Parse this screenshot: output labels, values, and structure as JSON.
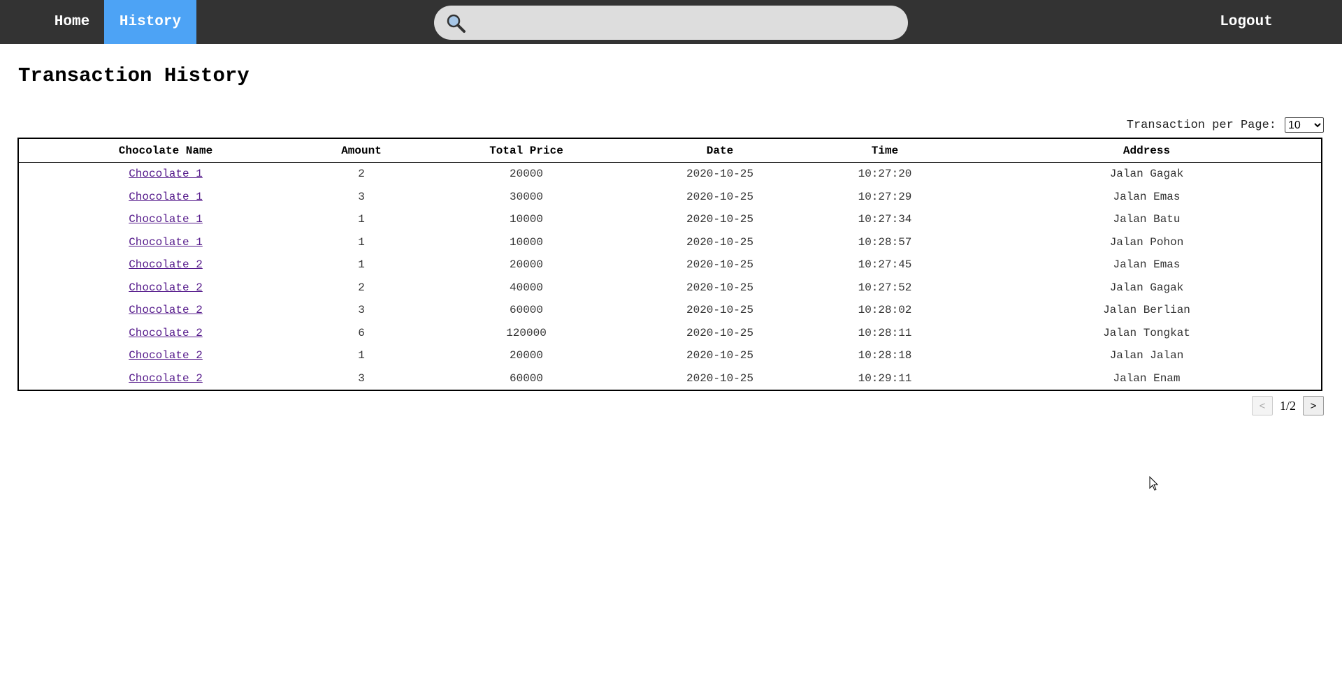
{
  "nav": {
    "home": "Home",
    "history": "History",
    "logout": "Logout"
  },
  "search": {
    "icon": "search-icon",
    "value": "",
    "placeholder": ""
  },
  "page_title": "Transaction History",
  "per_page": {
    "label": "Transaction per Page:",
    "selected": "10"
  },
  "table": {
    "headers": [
      "Chocolate Name",
      "Amount",
      "Total Price",
      "Date",
      "Time",
      "Address"
    ],
    "rows": [
      [
        "Chocolate 1",
        "2",
        "20000",
        "2020-10-25",
        "10:27:20",
        "Jalan Gagak"
      ],
      [
        "Chocolate 1",
        "3",
        "30000",
        "2020-10-25",
        "10:27:29",
        "Jalan Emas"
      ],
      [
        "Chocolate 1",
        "1",
        "10000",
        "2020-10-25",
        "10:27:34",
        "Jalan Batu"
      ],
      [
        "Chocolate 1",
        "1",
        "10000",
        "2020-10-25",
        "10:28:57",
        "Jalan Pohon"
      ],
      [
        "Chocolate 2",
        "1",
        "20000",
        "2020-10-25",
        "10:27:45",
        "Jalan Emas"
      ],
      [
        "Chocolate 2",
        "2",
        "40000",
        "2020-10-25",
        "10:27:52",
        "Jalan Gagak"
      ],
      [
        "Chocolate 2",
        "3",
        "60000",
        "2020-10-25",
        "10:28:02",
        "Jalan Berlian"
      ],
      [
        "Chocolate 2",
        "6",
        "120000",
        "2020-10-25",
        "10:28:11",
        "Jalan Tongkat"
      ],
      [
        "Chocolate 2",
        "1",
        "20000",
        "2020-10-25",
        "10:28:18",
        "Jalan Jalan"
      ],
      [
        "Chocolate 2",
        "3",
        "60000",
        "2020-10-25",
        "10:29:11",
        "Jalan Enam"
      ]
    ]
  },
  "pager": {
    "prev": "<",
    "next": ">",
    "indicator": "1/2"
  },
  "colors": {
    "navbar": "#333333",
    "active_nav": "#4da3f5",
    "search_bg": "#dddddd",
    "link": "#551a8b"
  }
}
